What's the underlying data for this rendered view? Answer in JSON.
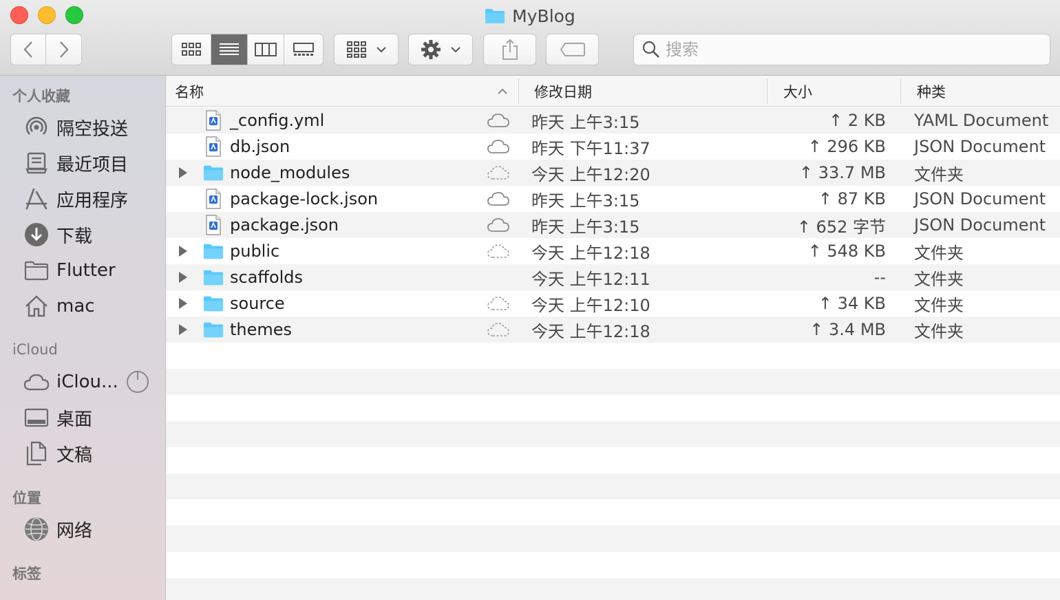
{
  "window": {
    "title": "MyBlog",
    "colors": {
      "close": "#fe5f57",
      "minimize": "#febc2e",
      "zoom": "#28c840",
      "folder": "#5ac8fa"
    }
  },
  "toolbar": {
    "search_placeholder": "搜索",
    "view_modes": [
      "icon-view",
      "list-view",
      "column-view",
      "gallery-view"
    ],
    "active_view": "list-view"
  },
  "sidebar": {
    "favorites_heading": "个人收藏",
    "favorites": [
      {
        "label": "隔空投送",
        "icon": "airdrop-icon"
      },
      {
        "label": "最近项目",
        "icon": "recents-icon"
      },
      {
        "label": "应用程序",
        "icon": "applications-icon"
      },
      {
        "label": "下载",
        "icon": "downloads-icon"
      },
      {
        "label": "Flutter",
        "icon": "folder-icon"
      },
      {
        "label": "mac",
        "icon": "home-icon"
      }
    ],
    "icloud_heading": "iCloud",
    "icloud": [
      {
        "label": "iClou...",
        "icon": "cloud-icon"
      },
      {
        "label": "桌面",
        "icon": "desktop-icon"
      },
      {
        "label": "文稿",
        "icon": "documents-icon"
      }
    ],
    "locations_heading": "位置",
    "locations": [
      {
        "label": "网络",
        "icon": "network-icon"
      }
    ],
    "tags_heading": "标签"
  },
  "columns": {
    "name": "名称",
    "date": "修改日期",
    "size": "大小",
    "kind": "种类"
  },
  "files": [
    {
      "name": "_config.yml",
      "type": "file",
      "cloud": "uploaded",
      "date": "昨天 上午3:15",
      "size": "↑ 2 KB",
      "kind": "YAML Document"
    },
    {
      "name": "db.json",
      "type": "file",
      "cloud": "uploaded",
      "date": "昨天 下午11:37",
      "size": "↑ 296 KB",
      "kind": "JSON Document"
    },
    {
      "name": "node_modules",
      "type": "folder",
      "cloud": "pending",
      "date": "今天 上午12:20",
      "size": "↑ 33.7 MB",
      "kind": "文件夹"
    },
    {
      "name": "package-lock.json",
      "type": "file",
      "cloud": "uploaded",
      "date": "昨天 上午3:15",
      "size": "↑ 87 KB",
      "kind": "JSON Document"
    },
    {
      "name": "package.json",
      "type": "file",
      "cloud": "uploaded",
      "date": "昨天 上午3:15",
      "size": "↑ 652 字节",
      "kind": "JSON Document"
    },
    {
      "name": "public",
      "type": "folder",
      "cloud": "pending",
      "date": "今天 上午12:18",
      "size": "↑ 548 KB",
      "kind": "文件夹"
    },
    {
      "name": "scaffolds",
      "type": "folder",
      "cloud": "none",
      "date": "今天 上午12:11",
      "size": "--",
      "kind": "文件夹"
    },
    {
      "name": "source",
      "type": "folder",
      "cloud": "pending",
      "date": "今天 上午12:10",
      "size": "↑ 34 KB",
      "kind": "文件夹"
    },
    {
      "name": "themes",
      "type": "folder",
      "cloud": "pending",
      "date": "今天 上午12:18",
      "size": "↑ 3.4 MB",
      "kind": "文件夹"
    }
  ]
}
